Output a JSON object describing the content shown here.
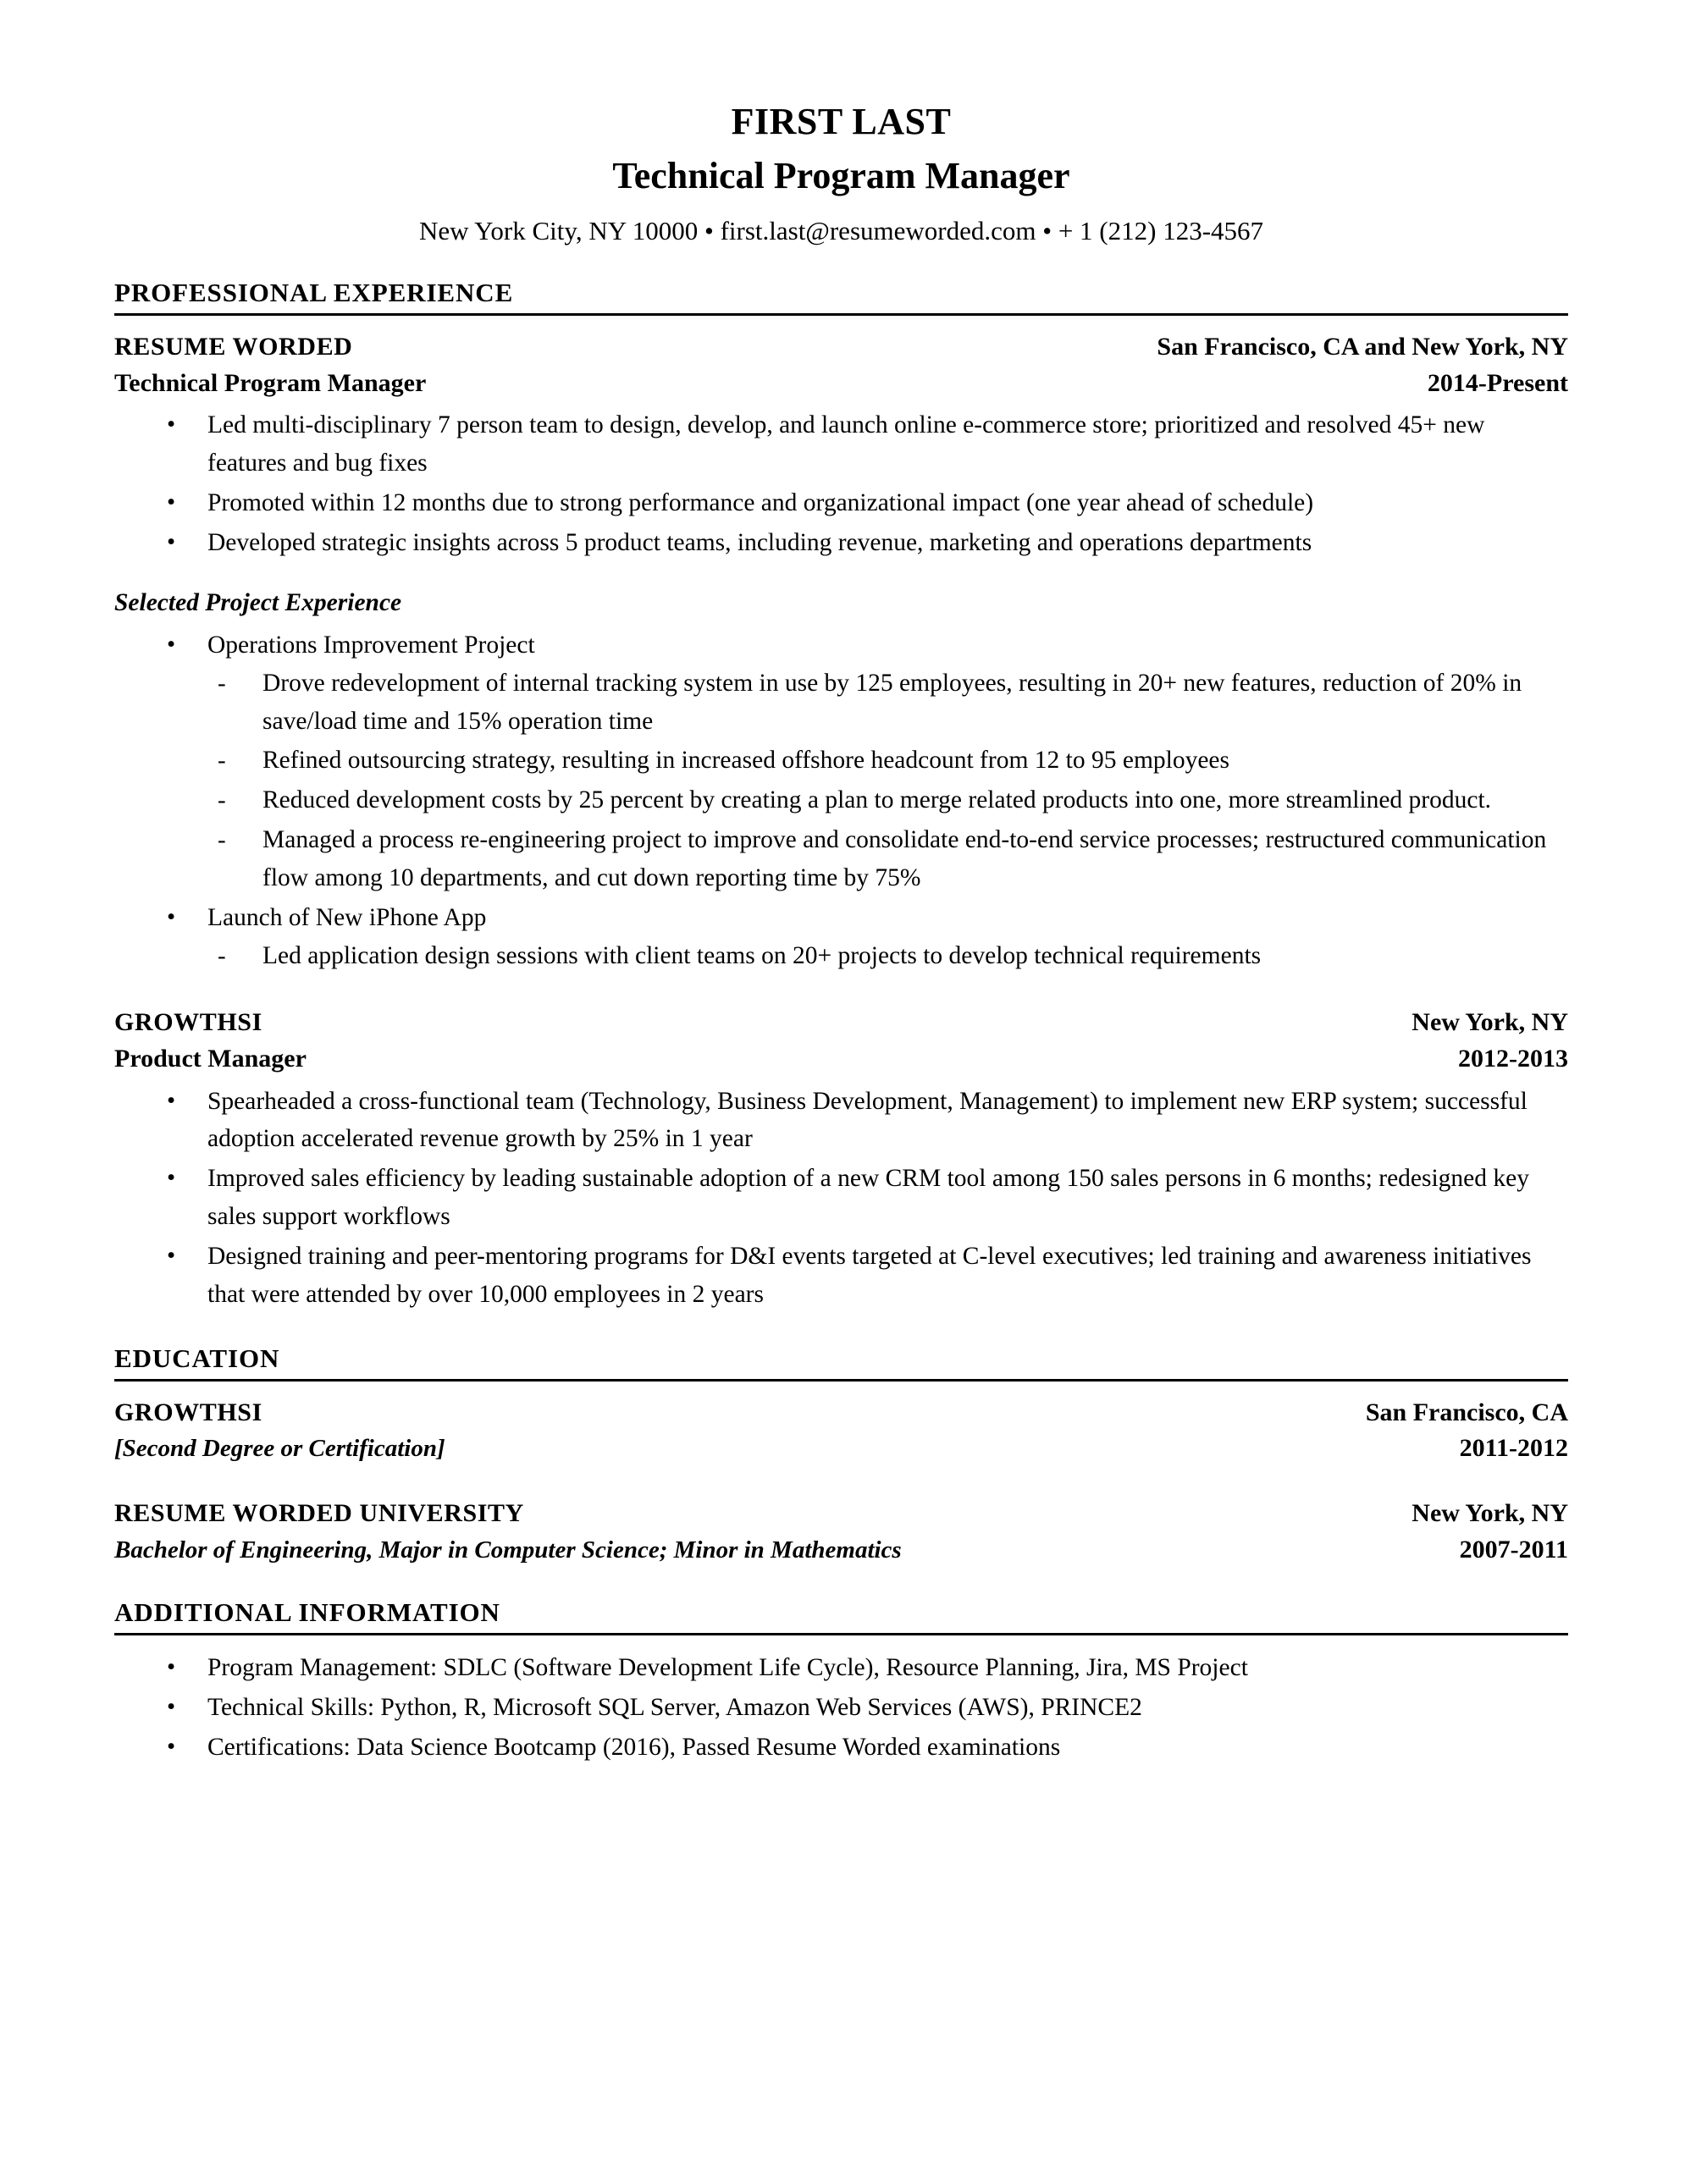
{
  "header": {
    "name": "FIRST LAST",
    "headline": "Technical Program Manager",
    "contact": "New York City, NY 10000 • first.last@resumeworded.com • + 1 (212) 123-4567"
  },
  "sections": {
    "experience": {
      "title": "PROFESSIONAL EXPERIENCE",
      "entries": [
        {
          "org": "RESUME WORDED",
          "location": "San Francisco, CA and New York, NY",
          "role": "Technical Program Manager",
          "dates": "2014-Present",
          "bullets": [
            "Led multi-disciplinary 7 person team to design, develop, and launch online e-commerce store; prioritized and resolved 45+ new features and bug fixes",
            "Promoted within 12 months due to strong performance and organizational impact (one year ahead of schedule)",
            "Developed strategic insights across 5 product teams, including revenue, marketing and operations departments"
          ],
          "subsection_title": "Selected Project Experience",
          "projects": [
            {
              "name": "Operations Improvement Project",
              "details": [
                "Drove redevelopment of internal tracking system in use by 125 employees, resulting in 20+ new features, reduction of 20% in save/load time and 15% operation time",
                "Refined outsourcing strategy, resulting in increased offshore headcount from 12 to 95 employees",
                "Reduced development costs by 25 percent by creating a plan to merge related products into one, more streamlined product.",
                "Managed a process re-engineering project to improve and consolidate end-to-end service processes; restructured communication flow among 10 departments, and cut down reporting time by 75%"
              ]
            },
            {
              "name": "Launch of New iPhone App",
              "details": [
                "Led application design sessions with client teams on 20+ projects to develop technical requirements"
              ]
            }
          ]
        },
        {
          "org": "GROWTHSI",
          "location": "New York, NY",
          "role": "Product Manager",
          "dates": "2012-2013",
          "bullets": [
            "Spearheaded a cross-functional team (Technology, Business Development, Management) to implement new ERP system; successful adoption accelerated revenue growth by 25% in 1 year",
            "Improved sales efficiency by leading sustainable adoption of a new CRM tool among 150 sales persons in 6 months; redesigned key sales support workflows",
            "Designed training and peer-mentoring programs for D&I events targeted at C-level executives; led training and awareness initiatives that were attended by over 10,000 employees in 2 years"
          ],
          "subsection_title": "",
          "projects": []
        }
      ]
    },
    "education": {
      "title": "EDUCATION",
      "entries": [
        {
          "org": "GROWTHSI",
          "location": "San Francisco, CA",
          "degree": "[Second Degree or Certification]",
          "dates": "2011-2012"
        },
        {
          "org": "RESUME WORDED UNIVERSITY",
          "location": "New York, NY",
          "degree": "Bachelor of Engineering, Major in Computer Science; Minor in Mathematics",
          "dates": "2007-2011"
        }
      ]
    },
    "additional": {
      "title": "ADDITIONAL INFORMATION",
      "bullets": [
        "Program Management: SDLC (Software Development Life Cycle), Resource Planning, Jira, MS Project",
        "Technical Skills: Python, R, Microsoft SQL Server, Amazon Web Services (AWS), PRINCE2",
        "Certifications: Data Science Bootcamp (2016), Passed Resume Worded examinations"
      ]
    }
  }
}
